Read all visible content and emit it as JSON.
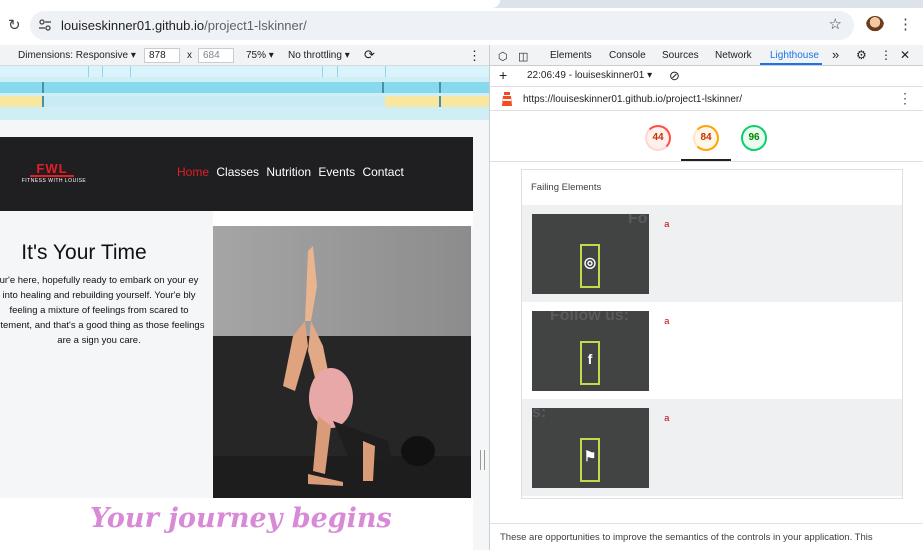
{
  "browser": {
    "url_host": "louiseskinner01.github.io",
    "url_path": "/project1-lskinner/"
  },
  "device_toolbar": {
    "dimensions_label": "Dimensions: Responsive ▾",
    "width": "878",
    "times": "x",
    "height": "684",
    "zoom": "75% ▾",
    "throttling": "No throttling ▾"
  },
  "site": {
    "logo_mark": "FWL",
    "logo_sub": "FITNESS WITH LOUISE",
    "nav": [
      "Home",
      "Classes",
      "Nutrition",
      "Events",
      "Contact"
    ],
    "hero_title": "It's Your Time",
    "hero_text": "ur'e here, hopefully ready to embark on your ey into healing and rebuilding yourself. Your'e bly feeling a mixture of feelings from scared to citement, and that's a good thing as those feelings are a sign you care.",
    "journey_heading": "Your journey begins"
  },
  "devtools": {
    "tabs": [
      "Elements",
      "Console",
      "Sources",
      "Network",
      "Lighthouse"
    ],
    "more_tabs": "»",
    "report_label": "22:06:49 - louiseskinner01 ▾",
    "add": "+",
    "report_url": "https://louiseskinner01.github.io/project1-lskinner/",
    "scores": [
      "44",
      "84",
      "96"
    ],
    "failing_header": "Failing Elements",
    "failing_items": [
      {
        "node": "a",
        "icon": "instagram-icon",
        "ghost_text": "Fo",
        "glyph": "◎"
      },
      {
        "node": "a",
        "icon": "facebook-icon",
        "ghost_text": "Follow us:",
        "glyph": "f"
      },
      {
        "node": "a",
        "icon": "twitter-icon",
        "ghost_text": "s:",
        "glyph": "⚑"
      }
    ],
    "footer_text": "These are opportunities to improve the semantics of the controls in your application. This"
  },
  "colors": {
    "brand_red": "#e31e24",
    "journey_pink": "#d98ad6",
    "lighthouse_blue": "#1a73e8",
    "score_red": "#ff4e42",
    "score_orange": "#ffa400",
    "score_green": "#0cce6b",
    "highlight": "#c3d84a"
  }
}
